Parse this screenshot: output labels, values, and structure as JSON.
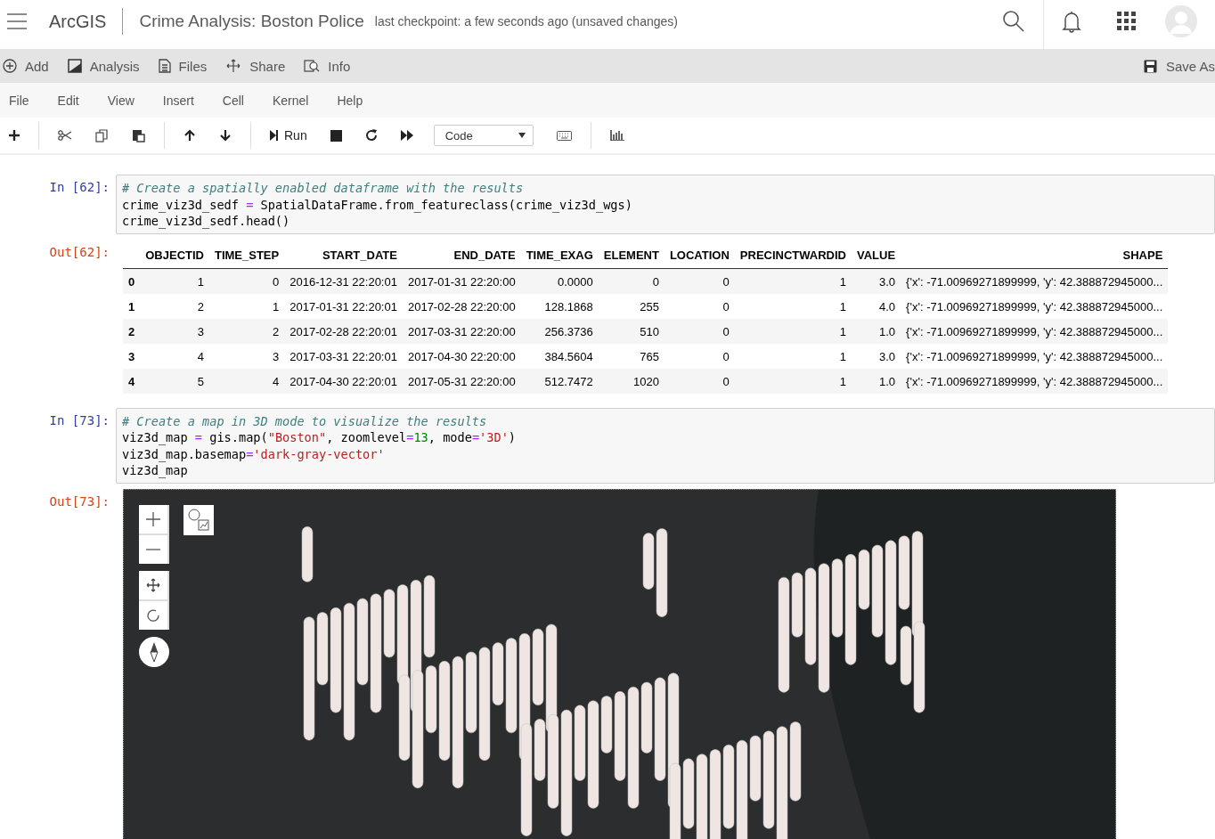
{
  "header": {
    "app_name": "ArcGIS",
    "notebook_title": "Crime Analysis: Boston Police",
    "checkpoint": "last checkpoint: a few seconds ago (unsaved changes)"
  },
  "action_bar": {
    "items": [
      {
        "kind": "add",
        "label": "Add"
      },
      {
        "kind": "analysis",
        "label": "Analysis"
      },
      {
        "kind": "files",
        "label": "Files"
      },
      {
        "kind": "share",
        "label": "Share"
      },
      {
        "kind": "info",
        "label": "Info"
      }
    ],
    "save": "Save As"
  },
  "menu": [
    "File",
    "Edit",
    "View",
    "Insert",
    "Cell",
    "Kernel",
    "Help"
  ],
  "toolbar": {
    "run": "Run",
    "cell_type": "Code"
  },
  "cells": [
    {
      "kind": "table",
      "in_prompt": "In [62]:",
      "out_prompt": "Out[62]:",
      "code": [
        [
          {
            "kind": "comment",
            "text": "# Create a spatially enabled dataframe with the results"
          }
        ],
        [
          {
            "kind": "plain",
            "text": "crime_viz3d_sedf "
          },
          {
            "kind": "op",
            "text": "="
          },
          {
            "kind": "plain",
            "text": " SpatialDataFrame.from_featureclass(crime_viz3d_wgs)"
          }
        ],
        [
          {
            "kind": "plain",
            "text": "crime_viz3d_sedf.head()"
          }
        ]
      ],
      "table": {
        "columns": [
          "",
          "OBJECTID",
          "TIME_STEP",
          "START_DATE",
          "END_DATE",
          "TIME_EXAG",
          "ELEMENT",
          "LOCATION",
          "PRECINCTWARDID",
          "VALUE",
          "SHAPE"
        ],
        "rows": [
          [
            "0",
            "1",
            "0",
            "2016-12-31 22:20:01",
            "2017-01-31 22:20:00",
            "0.0000",
            "0",
            "0",
            "1",
            "3.0",
            "{'x': -71.00969271899999, 'y': 42.388872945000..."
          ],
          [
            "1",
            "2",
            "1",
            "2017-01-31 22:20:01",
            "2017-02-28 22:20:00",
            "128.1868",
            "255",
            "0",
            "1",
            "4.0",
            "{'x': -71.00969271899999, 'y': 42.388872945000..."
          ],
          [
            "2",
            "3",
            "2",
            "2017-02-28 22:20:01",
            "2017-03-31 22:20:00",
            "256.3736",
            "510",
            "0",
            "1",
            "1.0",
            "{'x': -71.00969271899999, 'y': 42.388872945000..."
          ],
          [
            "3",
            "4",
            "3",
            "2017-03-31 22:20:01",
            "2017-04-30 22:20:00",
            "384.5604",
            "765",
            "0",
            "1",
            "3.0",
            "{'x': -71.00969271899999, 'y': 42.388872945000..."
          ],
          [
            "4",
            "5",
            "4",
            "2017-04-30 22:20:01",
            "2017-05-31 22:20:00",
            "512.7472",
            "1020",
            "0",
            "1",
            "1.0",
            "{'x': -71.00969271899999, 'y': 42.388872945000..."
          ]
        ]
      }
    },
    {
      "kind": "map",
      "in_prompt": "In [73]:",
      "out_prompt": "Out[73]:",
      "code": [
        [
          {
            "kind": "comment",
            "text": "# Create a map in 3D mode to visualize the results"
          }
        ],
        [
          {
            "kind": "plain",
            "text": "viz3d_map "
          },
          {
            "kind": "op",
            "text": "="
          },
          {
            "kind": "plain",
            "text": " gis.map("
          },
          {
            "kind": "string",
            "text": "\"Boston\""
          },
          {
            "kind": "plain",
            "text": ", zoomlevel"
          },
          {
            "kind": "op",
            "text": "="
          },
          {
            "kind": "number",
            "text": "13"
          },
          {
            "kind": "plain",
            "text": ", mode"
          },
          {
            "kind": "op",
            "text": "="
          },
          {
            "kind": "string",
            "text": "'3D'"
          },
          {
            "kind": "plain",
            "text": ")"
          }
        ],
        [
          {
            "kind": "plain",
            "text": "viz3d_map.basemap"
          },
          {
            "kind": "op",
            "text": "="
          },
          {
            "kind": "string",
            "text": "'dark-gray-vector'"
          }
        ],
        [
          {
            "kind": "plain",
            "text": "viz3d_map"
          }
        ]
      ]
    }
  ]
}
